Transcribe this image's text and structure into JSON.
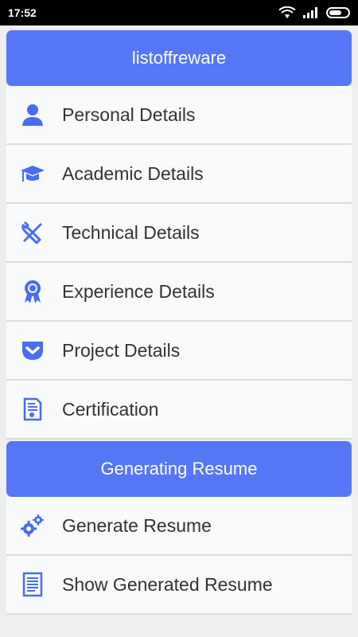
{
  "status_bar": {
    "time": "17:52"
  },
  "header": {
    "title": "listoffreware"
  },
  "menu": {
    "items": [
      {
        "label": "Personal Details",
        "icon": "user-icon"
      },
      {
        "label": "Academic Details",
        "icon": "graduation-cap-icon"
      },
      {
        "label": "Technical Details",
        "icon": "tools-icon"
      },
      {
        "label": "Experience Details",
        "icon": "ribbon-award-icon"
      },
      {
        "label": "Project Details",
        "icon": "pocket-chevron-icon"
      },
      {
        "label": "Certification",
        "icon": "certificate-icon"
      }
    ]
  },
  "section": {
    "title": "Generating Resume",
    "items": [
      {
        "label": "Generate Resume",
        "icon": "gears-icon"
      },
      {
        "label": "Show Generated Resume",
        "icon": "document-icon"
      }
    ]
  },
  "colors": {
    "accent": "#5577f5",
    "icon": "#4a6cf0",
    "item_bg": "#f9fafc",
    "divider": "#dcdcdc"
  }
}
